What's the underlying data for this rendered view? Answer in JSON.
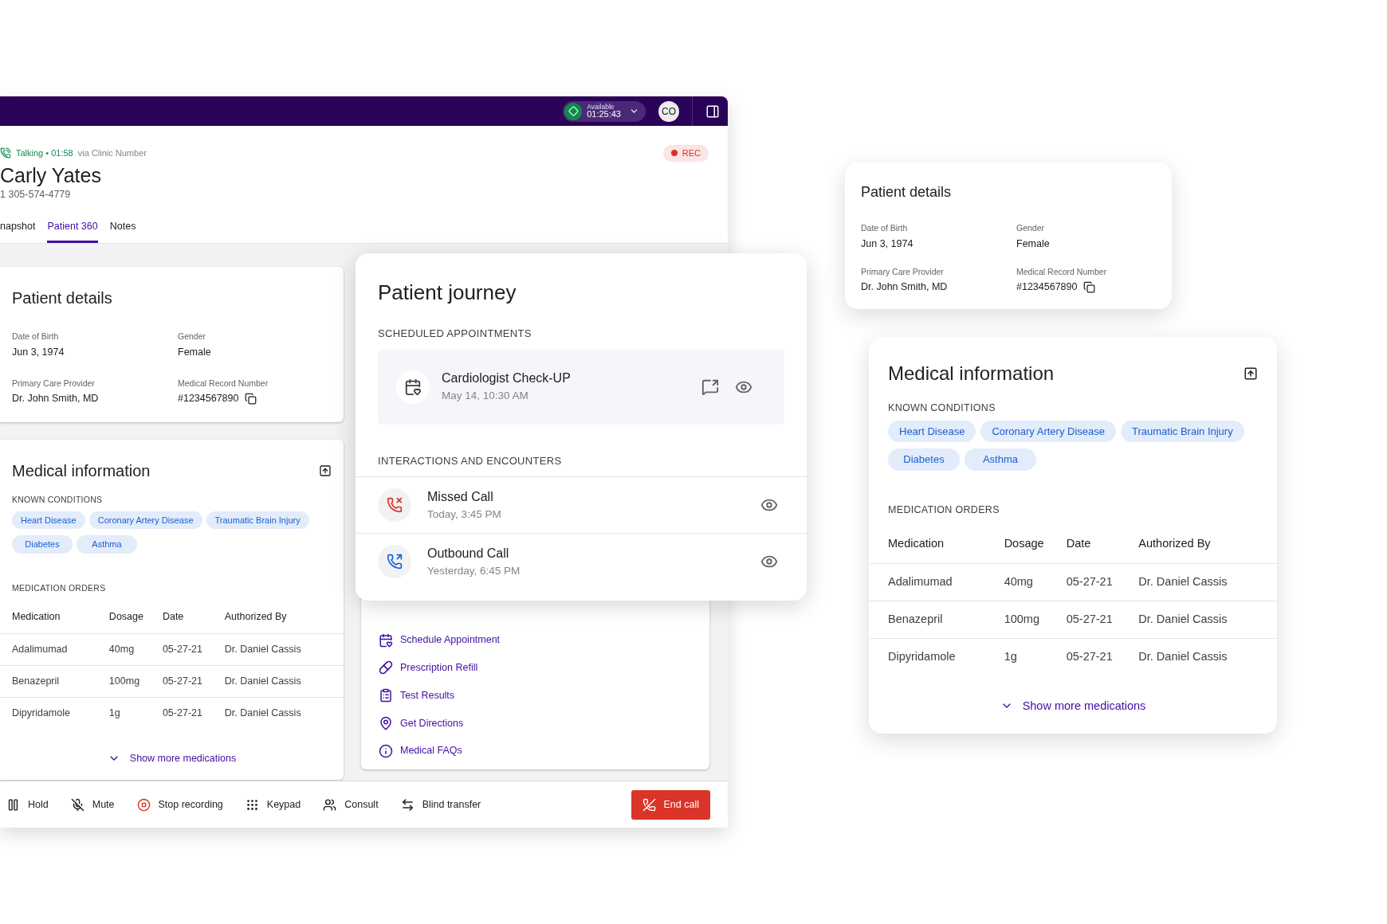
{
  "top_bar": {
    "status": "Available",
    "timer": "01:25:43",
    "avatar": "CO"
  },
  "call": {
    "status": "Talking • 01:58",
    "via": "via Clinic Number",
    "recording": "REC",
    "name": "Carly Yates",
    "phone": "1 305-574-4779"
  },
  "tabs": [
    {
      "label": "napshot",
      "selected": false
    },
    {
      "label": "Patient 360",
      "selected": true
    },
    {
      "label": "Notes",
      "selected": false
    }
  ],
  "patient_details": {
    "title": "Patient details",
    "fields": [
      {
        "label": "Date of Birth",
        "value": "Jun 3, 1974",
        "copyable": false
      },
      {
        "label": "Gender",
        "value": "Female",
        "copyable": false
      },
      {
        "label": "Primary Care Provider",
        "value": "Dr. John Smith, MD",
        "copyable": false
      },
      {
        "label": "Medical Record Number",
        "value": "#1234567890",
        "copyable": true
      }
    ]
  },
  "medical_information": {
    "title": "Medical information",
    "conditions_title": "KNOWN CONDITIONS",
    "conditions": [
      "Heart Disease",
      "Coronary Artery Disease",
      "Traumatic Brain Injury",
      "Diabetes",
      "Asthma"
    ],
    "orders_title": "MEDICATION ORDERS",
    "columns": [
      "Medication",
      "Dosage",
      "Date",
      "Authorized By"
    ],
    "rows": [
      [
        "Adalimumad",
        "40mg",
        "05-27-21",
        "Dr. Daniel Cassis"
      ],
      [
        "Benazepril",
        "100mg",
        "05-27-21",
        "Dr. Daniel Cassis"
      ],
      [
        "Dipyridamole",
        "1g",
        "05-27-21",
        "Dr. Daniel Cassis"
      ]
    ],
    "show_more": "Show more medications"
  },
  "quick_links": [
    {
      "label": "Schedule Appointment",
      "kind": "calendar"
    },
    {
      "label": "Prescription Refill",
      "kind": "pill"
    },
    {
      "label": "Test Results",
      "kind": "clipboard"
    },
    {
      "label": "Get Directions",
      "kind": "pin"
    },
    {
      "label": "Medical FAQs",
      "kind": "info"
    }
  ],
  "patient_journey": {
    "title": "Patient journey",
    "appointments_title": "SCHEDULED APPOINTMENTS",
    "appointments": [
      {
        "title": "Cardiologist Check-UP",
        "time": "May 14, 10:30 AM"
      }
    ],
    "interactions_title": "INTERACTIONS AND ENCOUNTERS",
    "interactions": [
      {
        "title": "Missed Call",
        "time": "Today, 3:45 PM",
        "kind": "missed"
      },
      {
        "title": "Outbound Call",
        "time": "Yesterday, 6:45 PM",
        "kind": "outbound"
      }
    ]
  },
  "call_controls": [
    {
      "label": "Hold",
      "kind": "hold"
    },
    {
      "label": "Mute",
      "kind": "mute"
    },
    {
      "label": "Stop recording",
      "kind": "stop"
    },
    {
      "label": "Keypad",
      "kind": "keypad"
    },
    {
      "label": "Consult",
      "kind": "consult"
    },
    {
      "label": "Blind transfer",
      "kind": "transfer"
    }
  ],
  "end_call": "End call",
  "floating_patient_details": {
    "title": "Patient details",
    "fields": [
      {
        "label": "Date of Birth",
        "value": "Jun 3, 1974",
        "copyable": false
      },
      {
        "label": "Gender",
        "value": "Female",
        "copyable": false
      },
      {
        "label": "Primary Care Provider",
        "value": "Dr. John Smith, MD",
        "copyable": false
      },
      {
        "label": "Medical Record Number",
        "value": "#1234567890",
        "copyable": true
      }
    ]
  },
  "floating_medical_information": {
    "title": "Medical information",
    "conditions_title": "KNOWN CONDITIONS",
    "conditions": [
      "Heart Disease",
      "Coronary Artery Disease",
      "Traumatic Brain Injury",
      "Diabetes",
      "Asthma"
    ],
    "orders_title": "MEDICATION ORDERS",
    "columns": [
      "Medication",
      "Dosage",
      "Date",
      "Authorized By"
    ],
    "rows": [
      [
        "Adalimumad",
        "40mg",
        "05-27-21",
        "Dr. Daniel Cassis"
      ],
      [
        "Benazepril",
        "100mg",
        "05-27-21",
        "Dr. Daniel Cassis"
      ],
      [
        "Dipyridamole",
        "1g",
        "05-27-21",
        "Dr. Daniel Cassis"
      ]
    ],
    "show_more": "Show more medications"
  }
}
